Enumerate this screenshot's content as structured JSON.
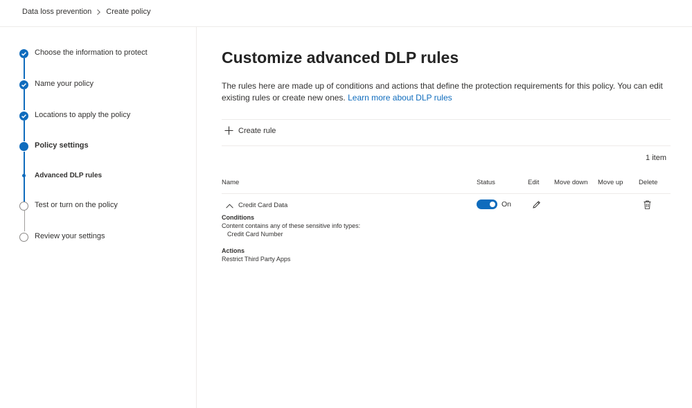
{
  "breadcrumb": {
    "items": [
      "Data loss prevention",
      "Create policy"
    ]
  },
  "wizard": {
    "steps": [
      {
        "label": "Choose the information to protect",
        "state": "done"
      },
      {
        "label": "Name your policy",
        "state": "done"
      },
      {
        "label": "Locations to apply the policy",
        "state": "done"
      },
      {
        "label": "Policy settings",
        "state": "current"
      },
      {
        "label": "Advanced DLP rules",
        "state": "current-substep"
      },
      {
        "label": "Test or turn on the policy",
        "state": "todo"
      },
      {
        "label": "Review your settings",
        "state": "todo"
      }
    ]
  },
  "main": {
    "title": "Customize advanced DLP rules",
    "description": "The rules here are made up of conditions and actions that define the protection requirements for this policy. You can edit existing rules or create new ones. ",
    "learn_more": "Learn more about DLP rules",
    "create_rule": "Create rule",
    "item_count": "1 item",
    "columns": {
      "name": "Name",
      "status": "Status",
      "edit": "Edit",
      "move_down": "Move down",
      "move_up": "Move up",
      "delete": "Delete"
    },
    "rule": {
      "name": "Credit Card Data",
      "status": "On",
      "conditions_heading": "Conditions",
      "conditions_text": "Content contains any of these sensitive info types:",
      "conditions_item": "Credit Card Number",
      "actions_heading": "Actions",
      "actions_text": "Restrict Third Party Apps"
    }
  },
  "colors": {
    "accent": "#0f6cbd",
    "divider": "#edebe9",
    "text": "#323130"
  },
  "icons": [
    "chevron-right-icon",
    "check-icon",
    "plus-icon",
    "chevron-up-icon",
    "edit-icon",
    "delete-icon"
  ]
}
